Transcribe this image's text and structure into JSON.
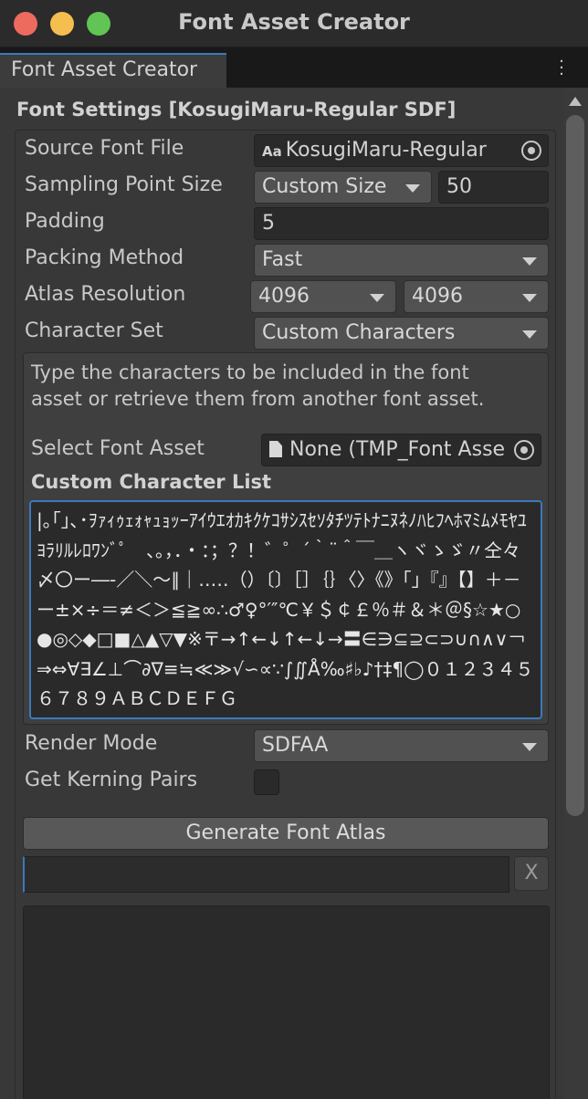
{
  "window": {
    "title": "Font Asset Creator",
    "tab_label": "Font Asset Creator"
  },
  "font_settings": {
    "section_title": "Font Settings [KosugiMaru-Regular SDF]",
    "source_font": {
      "label": "Source Font File",
      "icon_text": "Aa",
      "value": "KosugiMaru-Regular"
    },
    "sampling": {
      "label": "Sampling Point Size",
      "mode": "Custom Size",
      "size": "50"
    },
    "padding": {
      "label": "Padding",
      "value": "5"
    },
    "packing": {
      "label": "Packing Method",
      "value": "Fast"
    },
    "atlas": {
      "label": "Atlas Resolution",
      "width": "4096",
      "height": "4096"
    },
    "charset": {
      "label": "Character Set",
      "value": "Custom Characters"
    },
    "help_text": "Type the characters to be included in the font asset or retrieve them from another font asset.",
    "select_font_asset": {
      "label": "Select Font Asset",
      "value": "None (TMP_Font Asse"
    },
    "custom_list": {
      "label": "Custom Character List",
      "text": "|｡｢｣､･ｦｧｨｩｪｫｬｭｮｯｰｱｲｳｴｵｶｷｸｹｺｻｼｽｾｿﾀﾁﾂﾃﾄﾅﾆﾇﾈﾉﾊﾋﾌﾍﾎﾏﾐﾑﾒﾓﾔﾕﾖﾗﾘﾙﾚﾛﾜﾝﾞﾟ　、。，．・：；？！゛゜´｀¨＾￣＿ヽヾゝゞ〃仝々〆〇ー―‐／＼～∥｜…‥（）〔〕［］｛｝〈〉《》「」『』【】＋－ー±×÷＝≠＜＞≦≧∞∴♂♀°′″℃￥＄￠￡％＃＆＊＠§☆★○●◎◇◆□■△▲▽▼※〒→↑←↓↑←↓→〓∈∋⊆⊇⊂⊃∪∩∧∨￢⇒⇔∀∃∠⊥⌒∂∇≡≒≪≫√∽∝∵∫∬Å‰♯♭♪†‡¶◯０１２３４５６７８９ＡＢＣＤＥＦＧ"
    },
    "render_mode": {
      "label": "Render Mode",
      "value": "SDFAA"
    },
    "kerning": {
      "label": "Get Kerning Pairs",
      "checked": false
    },
    "generate_button": "Generate Font Atlas",
    "clear_button": "X"
  }
}
